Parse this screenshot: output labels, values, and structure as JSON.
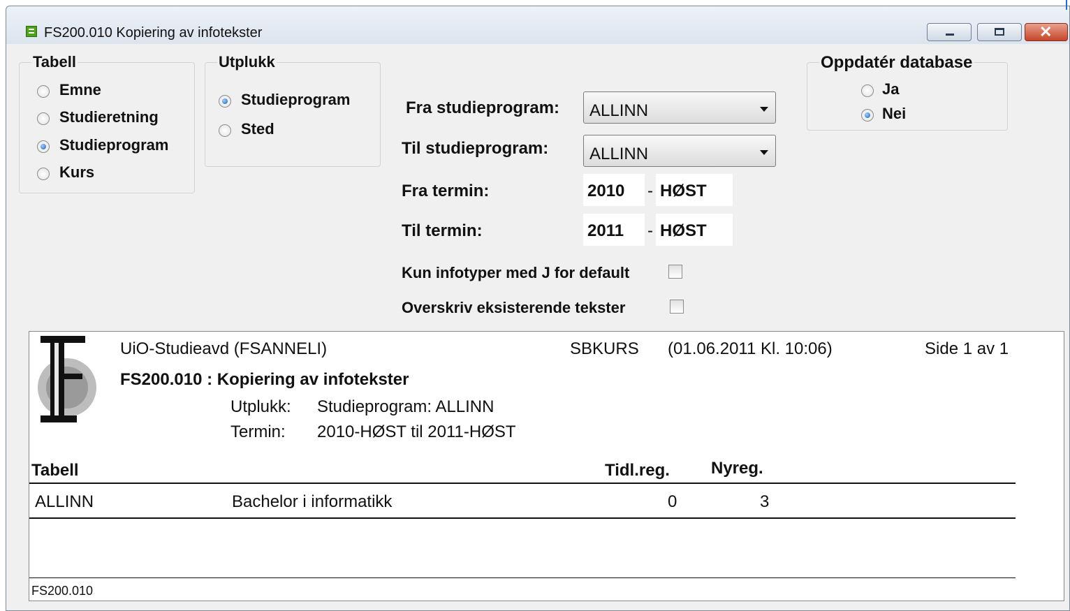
{
  "window": {
    "title": "FS200.010 Kopiering av infotekster"
  },
  "tabell": {
    "legend": "Tabell",
    "options": [
      "Emne",
      "Studieretning",
      "Studieprogram",
      "Kurs"
    ],
    "selected": "Studieprogram"
  },
  "utplukk": {
    "legend": "Utplukk",
    "options": [
      "Studieprogram",
      "Sted"
    ],
    "selected": "Studieprogram"
  },
  "oppdater": {
    "legend": "Oppdatér database",
    "options": [
      "Ja",
      "Nei"
    ],
    "selected": "Nei"
  },
  "form": {
    "fra_studieprogram_label": "Fra studieprogram:",
    "fra_studieprogram_value": "ALLINN",
    "til_studieprogram_label": "Til studieprogram:",
    "til_studieprogram_value": "ALLINN",
    "fra_termin_label": "Fra termin:",
    "fra_termin_year": "2010",
    "fra_termin_term": "HØST",
    "til_termin_label": "Til termin:",
    "til_termin_year": "2011",
    "til_termin_term": "HØST",
    "kun_infotyper_label": "Kun infotyper med J for default",
    "kun_infotyper_checked": false,
    "overskriv_label": "Overskriv eksisterende tekster",
    "overskriv_checked": false
  },
  "report": {
    "org": "UiO-Studieavd (FSANNELI)",
    "system": "SBKURS",
    "datetime": "(01.06.2011 Kl. 10:06)",
    "page": "Side 1 av 1",
    "title": "FS200.010 : Kopiering av infotekster",
    "utplukk_label": "Utplukk:",
    "utplukk_value": "Studieprogram: ALLINN",
    "termin_label": "Termin:",
    "termin_value": "2010-HØST til 2011-HØST",
    "columns": {
      "tabell": "Tabell",
      "tidl": "Tidl.reg.",
      "nyreg": "Nyreg."
    },
    "rows": [
      {
        "code": "ALLINN",
        "name": "Bachelor i informatikk",
        "tidl": "0",
        "nyreg": "3"
      }
    ],
    "footer": "FS200.010"
  }
}
